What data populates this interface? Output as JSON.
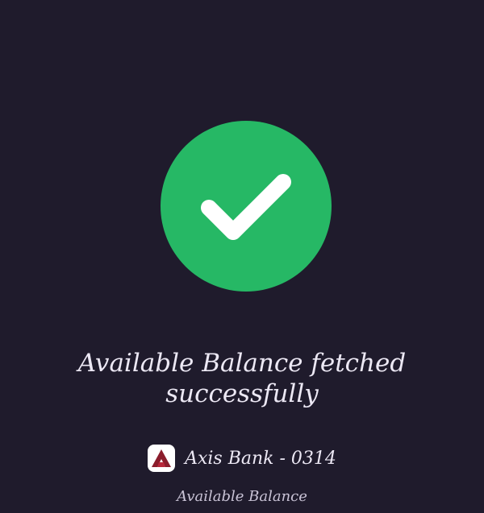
{
  "colors": {
    "background": "#1f1b2c",
    "success": "#26b865",
    "check": "#ffffff",
    "text": "#ece8f4",
    "axis_logo": "#8b1d2c"
  },
  "status": {
    "icon": "checkmark-icon",
    "message": "Available Balance fetched successfully"
  },
  "account": {
    "logo_icon": "axis-bank-logo-icon",
    "label": "Axis Bank - 0314"
  },
  "balance": {
    "label": "Available Balance"
  }
}
